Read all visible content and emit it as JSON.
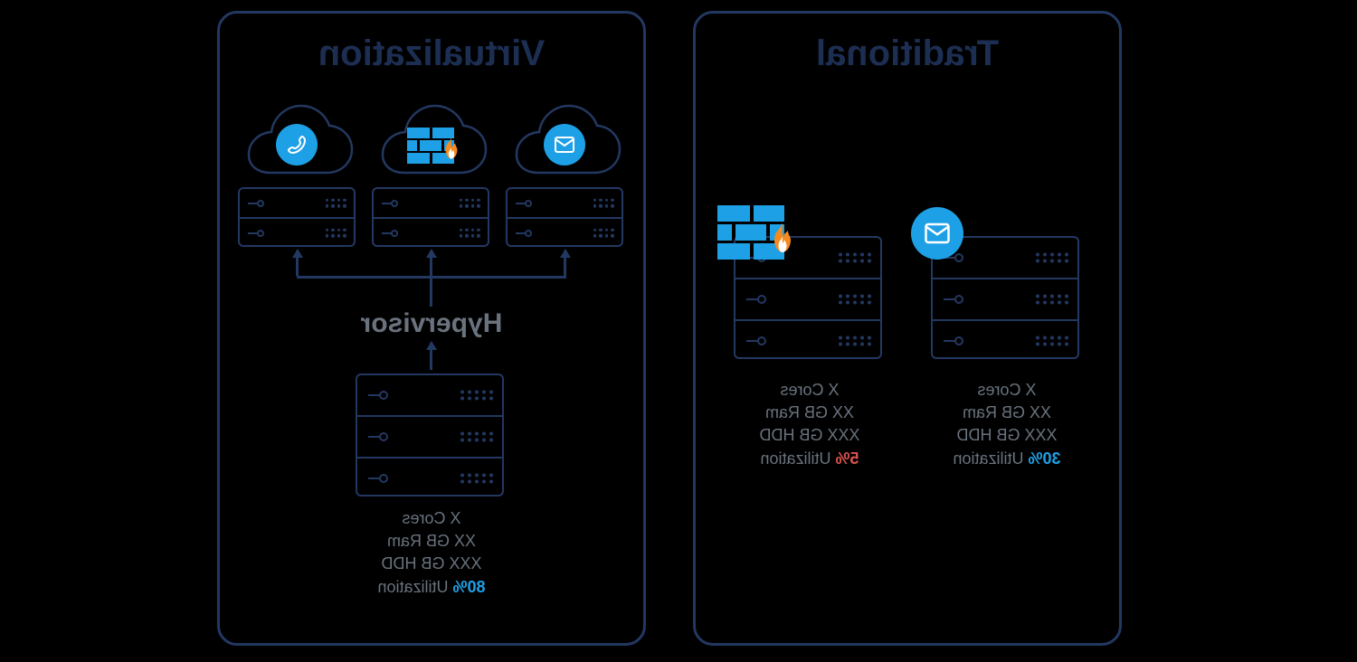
{
  "panels": {
    "traditional": {
      "title": "Traditional",
      "servers": [
        {
          "icon": "mail",
          "specs": {
            "cores": "X Cores",
            "ram": "XX GB Ram",
            "hdd": "XXX GB HDD",
            "util_pct": "30%",
            "util_label": "Utilization",
            "util_class": "util-blue"
          }
        },
        {
          "icon": "firewall",
          "specs": {
            "cores": "X Cores",
            "ram": "XX GB Ram",
            "hdd": "XXX GB HDD",
            "util_pct": "5%",
            "util_label": "Utilization",
            "util_class": "util-red"
          }
        }
      ]
    },
    "virtualization": {
      "title": "Virtualization",
      "hypervisor_label": "Hypervisor",
      "host": {
        "specs": {
          "cores": "X Cores",
          "ram": "XX GB Ram",
          "hdd": "XXX GB HDD",
          "util_pct": "80%",
          "util_label": "Utilization",
          "util_class": "util-blue"
        }
      },
      "vms": [
        {
          "icon": "mail"
        },
        {
          "icon": "firewall"
        },
        {
          "icon": "phone"
        }
      ]
    }
  },
  "colors": {
    "navy": "#1c2e52",
    "stroke": "#233861",
    "grey": "#69727d",
    "blue": "#1ea0e6",
    "red": "#d9534f",
    "orange": "#f58a1f"
  }
}
